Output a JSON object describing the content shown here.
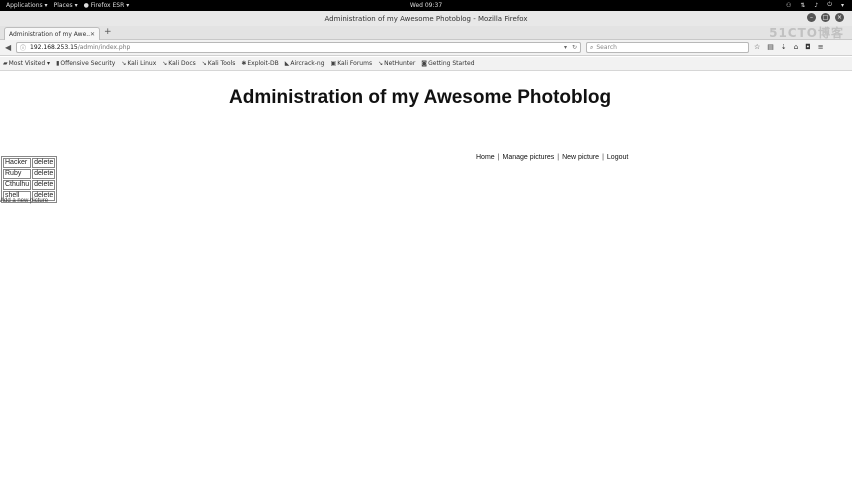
{
  "top_panel": {
    "applications": "Applications ▾",
    "places": "Places ▾",
    "active_app": "Firefox ESR ▾",
    "clock": "Wed 09:37",
    "tray_icons": [
      "user-icon",
      "network-icon",
      "volume-icon",
      "power-icon",
      "chevron-down-icon"
    ]
  },
  "browser": {
    "window_title": "Administration of my Awesome Photoblog - Mozilla Firefox",
    "tab_title": "Administration of my Awe...",
    "url_host": "192.168.253.15",
    "url_path": "/admin/index.php",
    "search_placeholder": "Search",
    "bookmarks": [
      {
        "label": "Most Visited ▾",
        "icon": "folder-icon"
      },
      {
        "label": "Offensive Security",
        "icon": "bookmark-icon"
      },
      {
        "label": "Kali Linux",
        "icon": "kali-icon"
      },
      {
        "label": "Kali Docs",
        "icon": "kali-icon"
      },
      {
        "label": "Kali Tools",
        "icon": "kali-icon"
      },
      {
        "label": "Exploit-DB",
        "icon": "exploit-icon"
      },
      {
        "label": "Aircrack-ng",
        "icon": "aircrack-icon"
      },
      {
        "label": "Kali Forums",
        "icon": "forum-icon"
      },
      {
        "label": "NetHunter",
        "icon": "kali-icon"
      },
      {
        "label": "Getting Started",
        "icon": "start-icon"
      }
    ]
  },
  "page": {
    "title": "Administration of my Awesome Photoblog",
    "nav": {
      "home": "Home",
      "manage": "Manage pictures",
      "new": "New picture",
      "logout": "Logout",
      "separator": "|"
    },
    "pictures": [
      {
        "name": "Hacker",
        "action": "delete"
      },
      {
        "name": "Ruby",
        "action": "delete"
      },
      {
        "name": "Cthulhu",
        "action": "delete"
      },
      {
        "name": "shell",
        "action": "delete"
      }
    ],
    "add_link": "Add a new picture"
  },
  "watermark": "51CTO博客"
}
